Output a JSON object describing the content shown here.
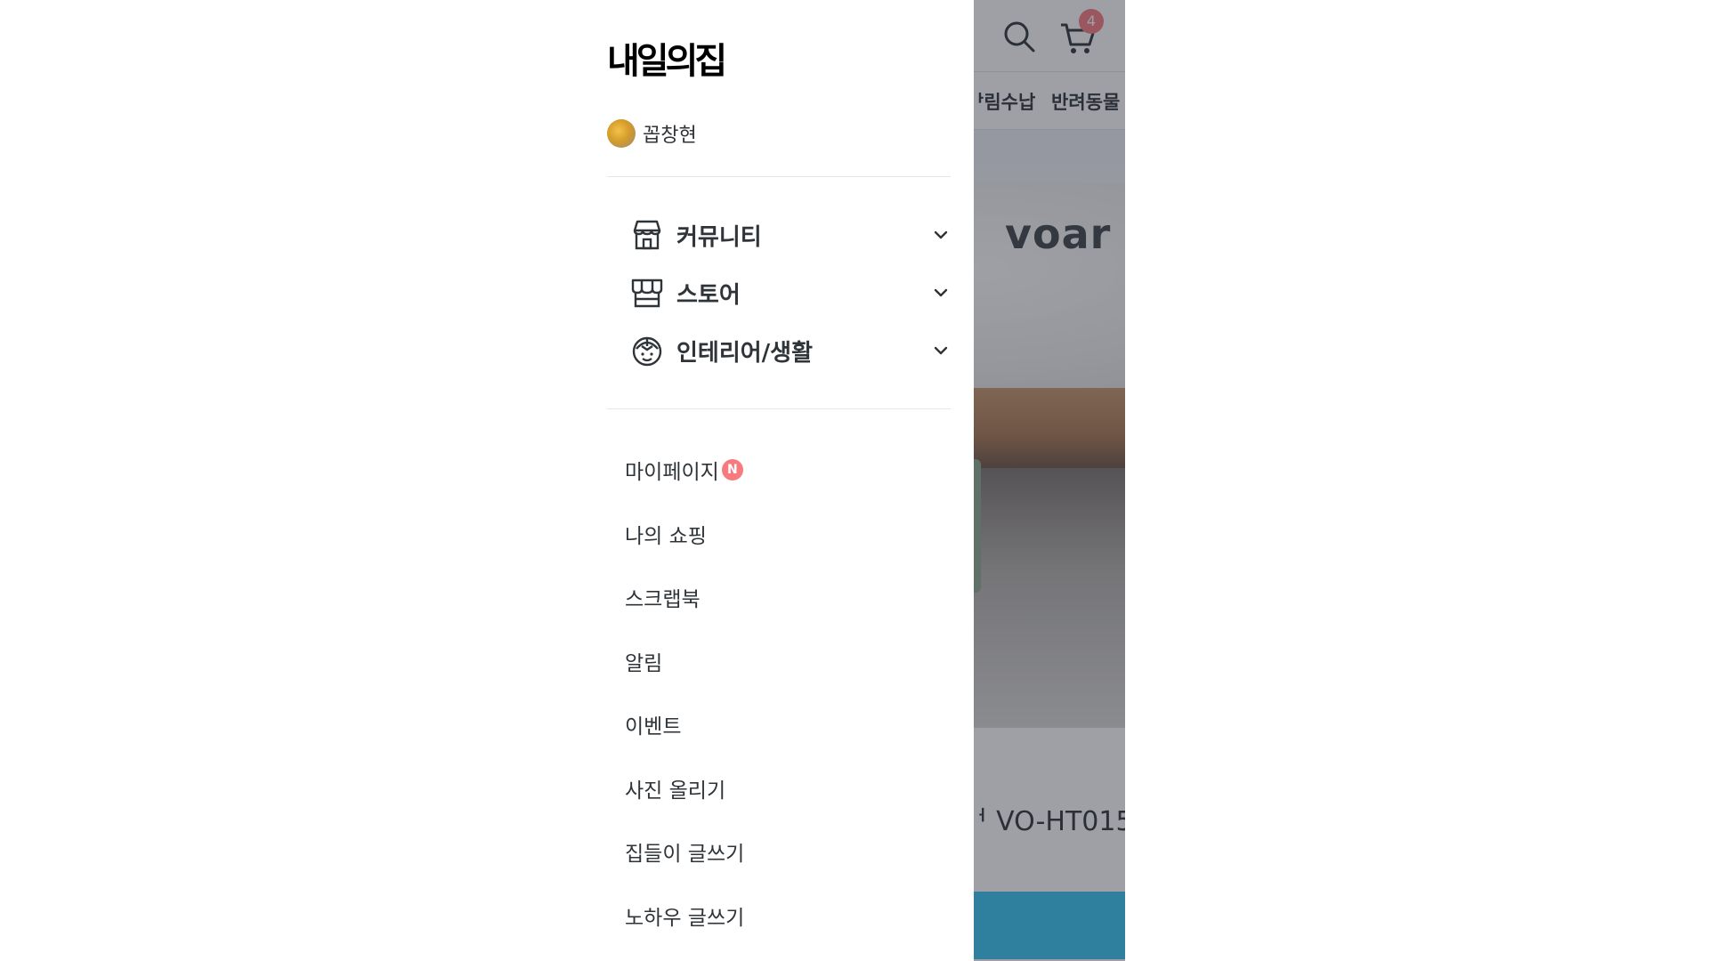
{
  "brand": {
    "logo_text": "내일의집"
  },
  "user": {
    "name": "꼽창현"
  },
  "sections": [
    {
      "label": "커뮤니티",
      "icon": "store-icon"
    },
    {
      "label": "스토어",
      "icon": "market-icon"
    },
    {
      "label": "인테리어/생활",
      "icon": "worker-helmet-icon"
    }
  ],
  "menu": [
    {
      "label": "마이페이지",
      "badge": "N"
    },
    {
      "label": "나의 쇼핑"
    },
    {
      "label": "스크랩북"
    },
    {
      "label": "알림"
    },
    {
      "label": "이벤트"
    },
    {
      "label": "사진 올리기"
    },
    {
      "label": "집들이 글쓰기"
    },
    {
      "label": "노하우 글쓰기"
    }
  ],
  "background_page": {
    "cart_count": "4",
    "categories": [
      "ᅡ림수납",
      "반려동물"
    ],
    "banner_brand": "voar",
    "product_title": "ᅥ VO-HT015"
  },
  "colors": {
    "accent": "#35c5f0",
    "badge": "#f77a7f",
    "text": "#2f3438"
  }
}
